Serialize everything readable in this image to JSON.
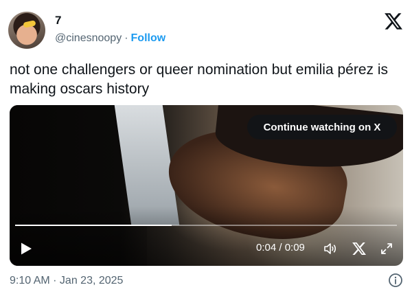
{
  "tweet": {
    "display_name": "7",
    "handle": "@cinesnoopy",
    "separator": "·",
    "follow_label": "Follow",
    "text": "not one challengers or queer nomination but emilia pérez is making oscars history",
    "timestamp": "9:10 AM · Jan 23, 2025"
  },
  "video": {
    "continue_label": "Continue watching on X",
    "current_time": "0:04",
    "duration": "0:09",
    "time_display": "0:04 / 0:09",
    "progress_fraction": 0.41
  },
  "icons": {
    "brand": "x-logo-icon",
    "play": "play-icon",
    "volume": "volume-icon",
    "video_brand": "x-logo-icon",
    "expand": "expand-icon",
    "info": "info-icon"
  },
  "colors": {
    "link": "#1d9bf0",
    "muted_text": "#536471",
    "text": "#0f1419"
  }
}
